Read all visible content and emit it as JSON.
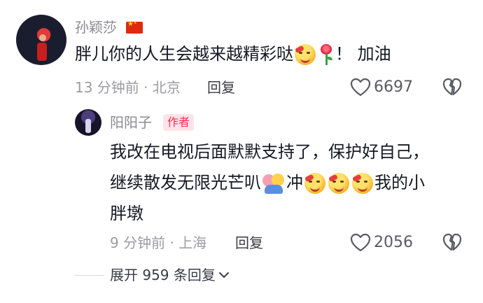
{
  "comment": {
    "author": "孙颖莎",
    "text_before": "胖儿你的人生会越来越精彩哒",
    "text_after": "！ 加油",
    "time": "13 分钟前",
    "location": "北京",
    "reply_label": "回复",
    "likes": "6697"
  },
  "reply": {
    "author": "阳阳子",
    "badge": "作者",
    "line1": "我改在电视后面默默支持了，保护好自己，",
    "line2_a": "继续散发无限光芒叭",
    "line2_b": "冲",
    "line2_c": "我的小",
    "line3": "胖墩",
    "time": "9 分钟前",
    "location": "上海",
    "reply_label": "回复",
    "likes": "2056"
  },
  "expand": {
    "label": "展开 959 条回复"
  },
  "icons": {
    "heart": "heart-outline-icon",
    "dislike": "broken-heart-icon",
    "chevron": "chevron-down-icon"
  },
  "colors": {
    "author_badge_bg": "#fde4e8",
    "author_badge_text": "#fe2c55",
    "flag_red": "#de2910"
  }
}
